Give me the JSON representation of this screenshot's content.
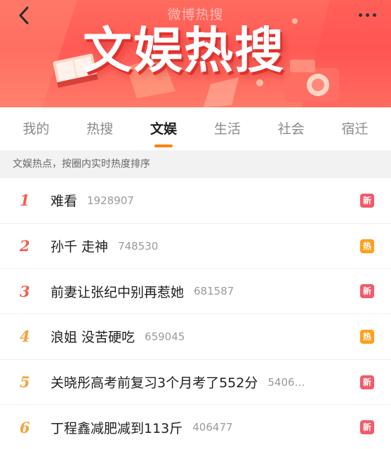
{
  "nav": {
    "title": "微博热搜",
    "back_icon": "chevron-left-icon",
    "more_icon": "more-dots-icon"
  },
  "banner": {
    "title": "文娱热搜"
  },
  "tabs": [
    {
      "label": "我的",
      "active": false
    },
    {
      "label": "热搜",
      "active": false
    },
    {
      "label": "文娱",
      "active": true
    },
    {
      "label": "生活",
      "active": false
    },
    {
      "label": "社会",
      "active": false
    },
    {
      "label": "宿迁",
      "active": false
    }
  ],
  "hint": "文娱热点，按圈内实时热度排序",
  "colors": {
    "new_badge": "#f25a6a",
    "hot_badge": "#ff9f1c",
    "rank_top": "#f55d4e",
    "rank_mid": "#f7a137",
    "tab_accent": "#ff8200"
  },
  "items": [
    {
      "rank": "1",
      "title": "难看",
      "count": "1928907",
      "badge": "新",
      "badge_type": "new"
    },
    {
      "rank": "2",
      "title": "孙千 走神",
      "count": "748530",
      "badge": "热",
      "badge_type": "hot"
    },
    {
      "rank": "3",
      "title": "前妻让张纪中别再惹她",
      "count": "681587",
      "badge": "新",
      "badge_type": "new"
    },
    {
      "rank": "4",
      "title": "浪姐 没苦硬吃",
      "count": "659045",
      "badge": "热",
      "badge_type": "hot"
    },
    {
      "rank": "5",
      "title": "关晓彤高考前复习3个月考了552分",
      "count": "5406…",
      "badge": "新",
      "badge_type": "new"
    },
    {
      "rank": "6",
      "title": "丁程鑫减肥减到113斤",
      "count": "406477",
      "badge": "新",
      "badge_type": "new"
    }
  ]
}
